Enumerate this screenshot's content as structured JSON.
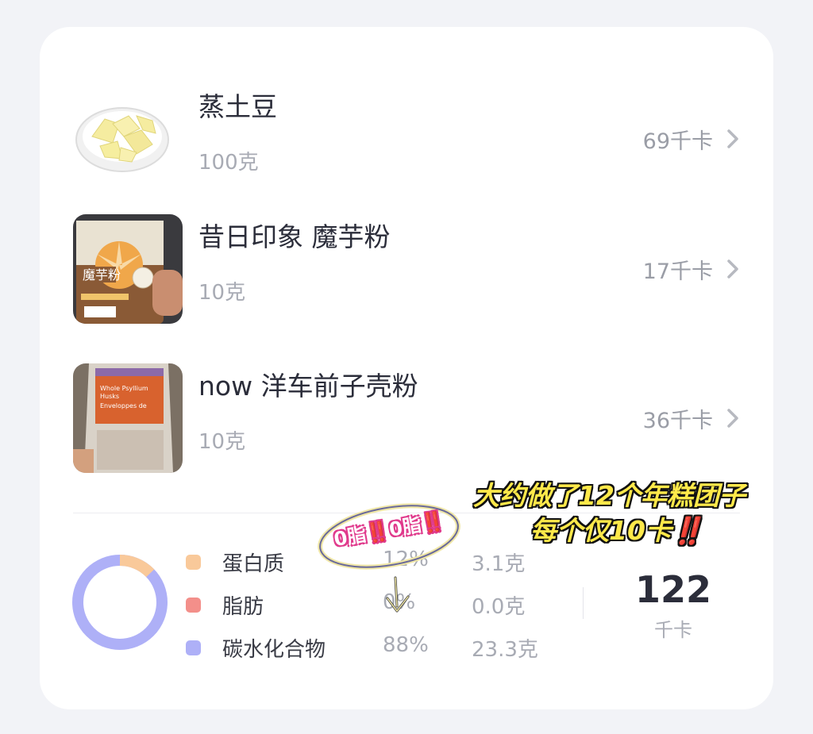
{
  "foods": [
    {
      "name": "蒸土豆",
      "amount": "100克",
      "kcal": "69千卡",
      "thumb_icon": "steamed-potato-plate-icon"
    },
    {
      "name": "昔日印象 魔芋粉",
      "amount": "10克",
      "kcal": "17千卡",
      "thumb_icon": "konjac-powder-package-icon"
    },
    {
      "name": "now 洋车前子壳粉",
      "amount": "10克",
      "kcal": "36千卡",
      "thumb_icon": "psyllium-husk-package-icon"
    }
  ],
  "nutrients": [
    {
      "name": "蛋白质",
      "percent": "12%",
      "grams": "3.1克",
      "color": "#f9c99a"
    },
    {
      "name": "脂肪",
      "percent": "0%",
      "grams": "0.0克",
      "color": "#f38f8a"
    },
    {
      "name": "碳水化合物",
      "percent": "88%",
      "grams": "23.3克",
      "color": "#aeb0f7"
    }
  ],
  "total": {
    "value": "122",
    "unit": "千卡"
  },
  "overlay": {
    "caption_line1": "大约做了12个年糕团子",
    "caption_line2": "每个仅10卡‼️",
    "sticker": "0脂‼️0脂‼️"
  },
  "colors": {
    "accent_text": "#2b2d3a",
    "muted_text": "#a8abb4",
    "background": "#f2f3f7"
  }
}
